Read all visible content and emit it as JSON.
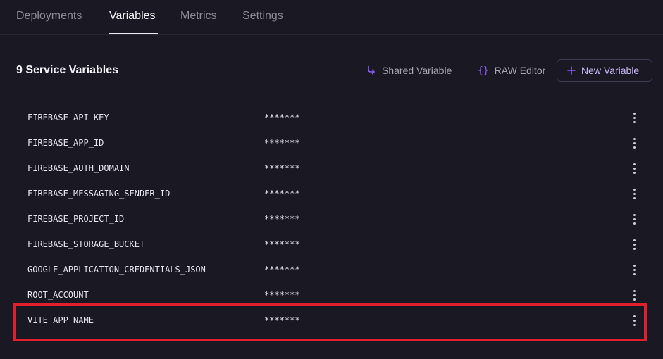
{
  "tabs": [
    {
      "label": "Deployments",
      "active": false
    },
    {
      "label": "Variables",
      "active": true
    },
    {
      "label": "Metrics",
      "active": false
    },
    {
      "label": "Settings",
      "active": false
    }
  ],
  "header": {
    "title": "9 Service Variables",
    "shared_variable_label": "Shared Variable",
    "shared_variable_icon": "shared-variable-arrow-icon",
    "raw_editor_label": "RAW Editor",
    "raw_editor_icon": "braces-icon",
    "new_variable_label": "New Variable",
    "new_variable_icon": "plus-icon"
  },
  "variables": [
    {
      "name": "FIREBASE_API_KEY",
      "value": "*******"
    },
    {
      "name": "FIREBASE_APP_ID",
      "value": "*******"
    },
    {
      "name": "FIREBASE_AUTH_DOMAIN",
      "value": "*******"
    },
    {
      "name": "FIREBASE_MESSAGING_SENDER_ID",
      "value": "*******"
    },
    {
      "name": "FIREBASE_PROJECT_ID",
      "value": "*******"
    },
    {
      "name": "FIREBASE_STORAGE_BUCKET",
      "value": "*******"
    },
    {
      "name": "GOOGLE_APPLICATION_CREDENTIALS_JSON",
      "value": "*******"
    },
    {
      "name": "ROOT_ACCOUNT",
      "value": "*******"
    },
    {
      "name": "VITE_APP_NAME",
      "value": "*******"
    }
  ],
  "colors": {
    "background": "#1a1823",
    "accent": "#8b5cf6",
    "highlight": "#e0202a"
  }
}
